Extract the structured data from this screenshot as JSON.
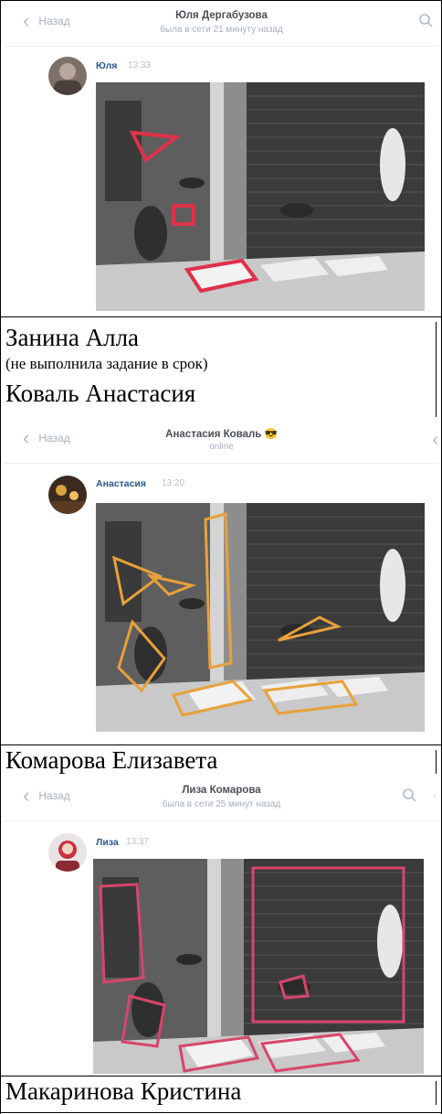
{
  "chats": [
    {
      "back_label": "Назад",
      "contact_name": "Юля Дергабузова",
      "status": "была в сети 21 минуту назад",
      "sender": "Юля",
      "time": "13:33"
    },
    {
      "back_label": "Назад",
      "contact_name": "Анастасия Коваль 😎",
      "status": "online",
      "sender": "Анастасия",
      "time": "13:20"
    },
    {
      "back_label": "Назад",
      "contact_name": "Лиза Комарова",
      "status": "была в сети 25 минут назад",
      "sender": "Лиза",
      "time": "13:37"
    }
  ],
  "captions": {
    "name1": "Занина Алла",
    "note1": "(не выполнила задание в срок)",
    "name2": "Коваль Анастасия",
    "name3": "Комарова Елизавета",
    "name4": "Макаринова Кристина"
  },
  "colors": {
    "highlight_red": "#e0304a",
    "highlight_orange": "#e8a13a",
    "highlight_pink": "#d8456a"
  }
}
